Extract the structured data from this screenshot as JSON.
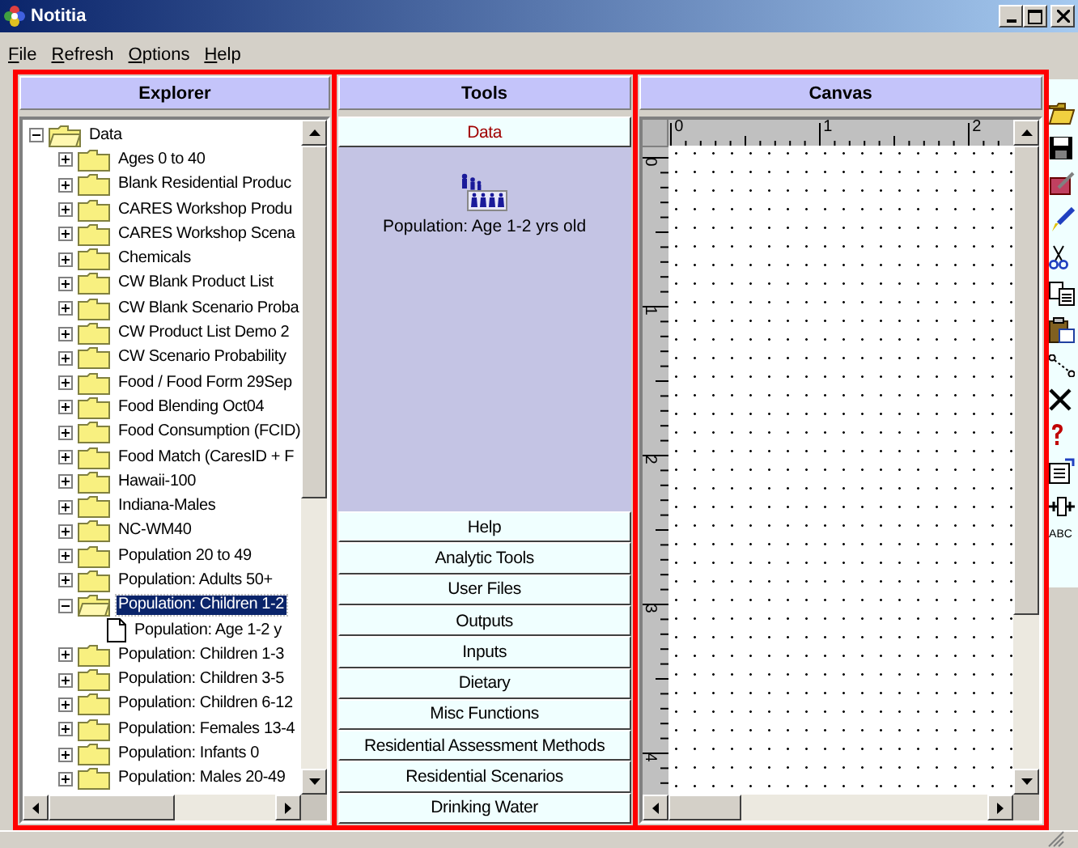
{
  "window": {
    "title": "Notitia"
  },
  "menu": [
    {
      "label": "File"
    },
    {
      "label": "Refresh"
    },
    {
      "label": "Options"
    },
    {
      "label": "Help"
    }
  ],
  "explorer": {
    "title": "Explorer",
    "tree": [
      {
        "label": "Data",
        "expanded": true,
        "selected": false,
        "children": [
          {
            "label": "Ages 0 to 40",
            "expanded": false,
            "selected": false
          },
          {
            "label": "Blank Residential Produc",
            "expanded": false,
            "selected": false
          },
          {
            "label": "CARES Workshop Produ",
            "expanded": false,
            "selected": false
          },
          {
            "label": "CARES Workshop Scena",
            "expanded": false,
            "selected": false
          },
          {
            "label": "Chemicals",
            "expanded": false,
            "selected": false
          },
          {
            "label": "CW Blank Product List",
            "expanded": false,
            "selected": false
          },
          {
            "label": "CW Blank Scenario Proba",
            "expanded": false,
            "selected": false
          },
          {
            "label": "CW Product List Demo 2",
            "expanded": false,
            "selected": false
          },
          {
            "label": "CW Scenario Probability",
            "expanded": false,
            "selected": false
          },
          {
            "label": "Food / Food Form 29Sep",
            "expanded": false,
            "selected": false
          },
          {
            "label": "Food Blending Oct04",
            "expanded": false,
            "selected": false
          },
          {
            "label": "Food Consumption (FCID)",
            "expanded": false,
            "selected": false
          },
          {
            "label": "Food Match (CaresID + F",
            "expanded": false,
            "selected": false
          },
          {
            "label": "Hawaii-100",
            "expanded": false,
            "selected": false
          },
          {
            "label": "Indiana-Males",
            "expanded": false,
            "selected": false
          },
          {
            "label": "NC-WM40",
            "expanded": false,
            "selected": false
          },
          {
            "label": "Population 20 to 49",
            "expanded": false,
            "selected": false
          },
          {
            "label": "Population: Adults 50+",
            "expanded": false,
            "selected": false
          },
          {
            "label": "Population: Children 1-2",
            "expanded": true,
            "selected": true,
            "children": [
              {
                "label": "Population: Age 1-2 y",
                "kind": "file",
                "selected": false
              }
            ]
          },
          {
            "label": "Population: Children 1-3",
            "expanded": false,
            "selected": false
          },
          {
            "label": "Population: Children 3-5",
            "expanded": false,
            "selected": false
          },
          {
            "label": "Population: Children 6-12",
            "expanded": false,
            "selected": false
          },
          {
            "label": "Population: Females 13-4",
            "expanded": false,
            "selected": false
          },
          {
            "label": "Population: Infants 0",
            "expanded": false,
            "selected": false
          },
          {
            "label": "Population: Males 20-49",
            "expanded": false,
            "selected": false
          }
        ]
      }
    ]
  },
  "tools": {
    "title": "Tools",
    "sections": [
      {
        "label": "Data",
        "selected": true,
        "items": [
          {
            "label": "Population: Age 1-2 yrs old"
          }
        ]
      },
      {
        "label": "Help",
        "selected": false
      },
      {
        "label": "Analytic Tools",
        "selected": false
      },
      {
        "label": "User Files",
        "selected": false
      },
      {
        "label": "Outputs",
        "selected": false
      },
      {
        "label": "Inputs",
        "selected": false
      },
      {
        "label": "Dietary",
        "selected": false
      },
      {
        "label": "Misc Functions",
        "selected": false
      },
      {
        "label": "Residential Assessment Methods",
        "selected": false
      },
      {
        "label": "Residential Scenarios",
        "selected": false
      },
      {
        "label": "Drinking Water",
        "selected": false
      }
    ]
  },
  "canvas": {
    "title": "Canvas",
    "top_ruler": [
      "0",
      "1",
      "2"
    ],
    "left_ruler": [
      "0",
      "1",
      "2",
      "3",
      "4"
    ]
  },
  "toolbar": {
    "text_tool": "ABC"
  }
}
